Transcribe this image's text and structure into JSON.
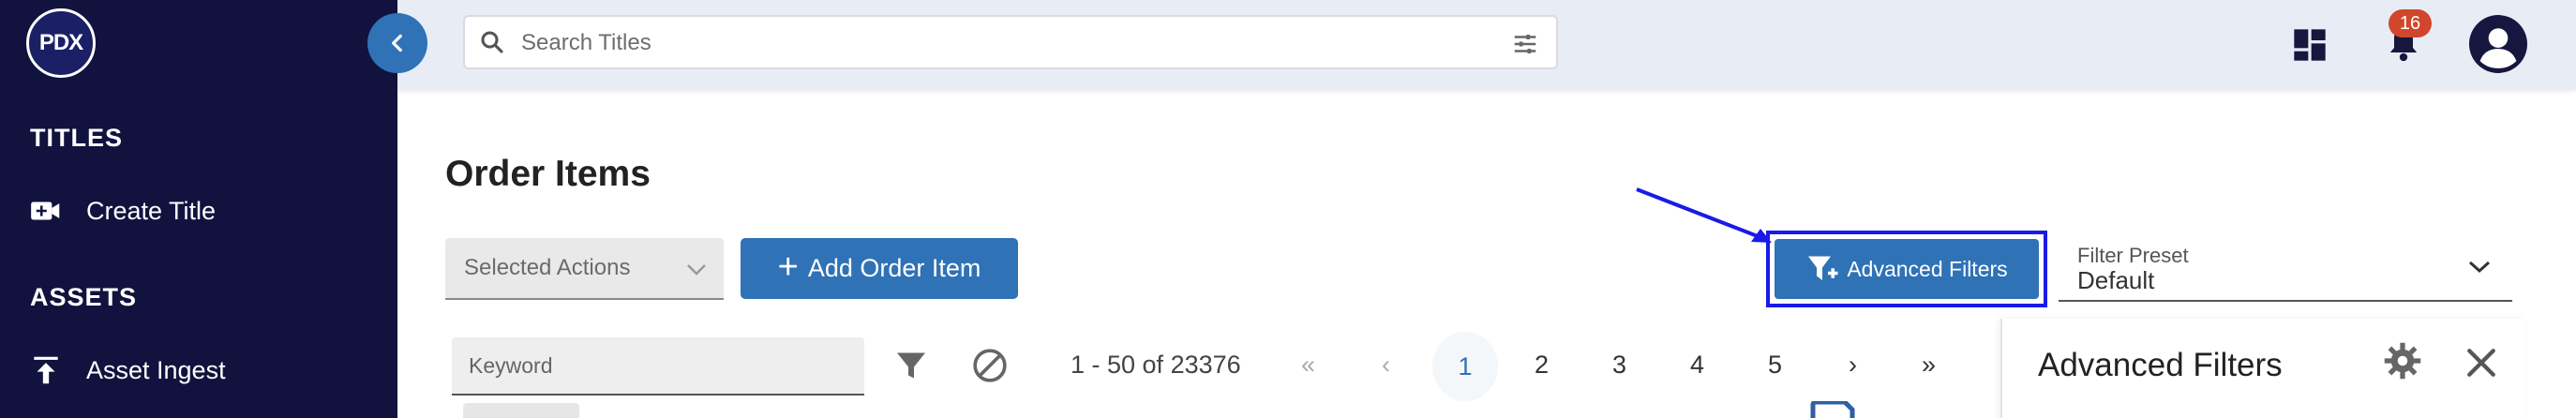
{
  "sidebar": {
    "logo_text": "PDX",
    "sections": [
      {
        "heading": "TITLES",
        "items": [
          {
            "label": "Create Title",
            "icon": "video-add-icon"
          }
        ]
      },
      {
        "heading": "ASSETS",
        "items": [
          {
            "label": "Asset Ingest",
            "icon": "upload-icon"
          }
        ]
      }
    ]
  },
  "topbar": {
    "search_placeholder": "Search Titles",
    "notification_count": "16"
  },
  "main": {
    "title": "Order Items",
    "selected_actions_label": "Selected Actions",
    "add_order_item_label": "Add Order Item",
    "advanced_filters_label": "Advanced Filters",
    "filter_preset": {
      "label": "Filter Preset",
      "value": "Default"
    },
    "keyword_placeholder": "Keyword",
    "range_text": "1 - 50 of 23376",
    "pagination": {
      "first": "«",
      "prev": "‹",
      "pages": [
        "1",
        "2",
        "3",
        "4",
        "5"
      ],
      "current": "1",
      "next": "›",
      "last": "»"
    }
  },
  "advanced_panel": {
    "title": "Advanced Filters"
  },
  "colors": {
    "sidebar_bg": "#12123f",
    "primary": "#2f72b6",
    "highlight": "#1a1ae8",
    "badge": "#d2462c"
  }
}
